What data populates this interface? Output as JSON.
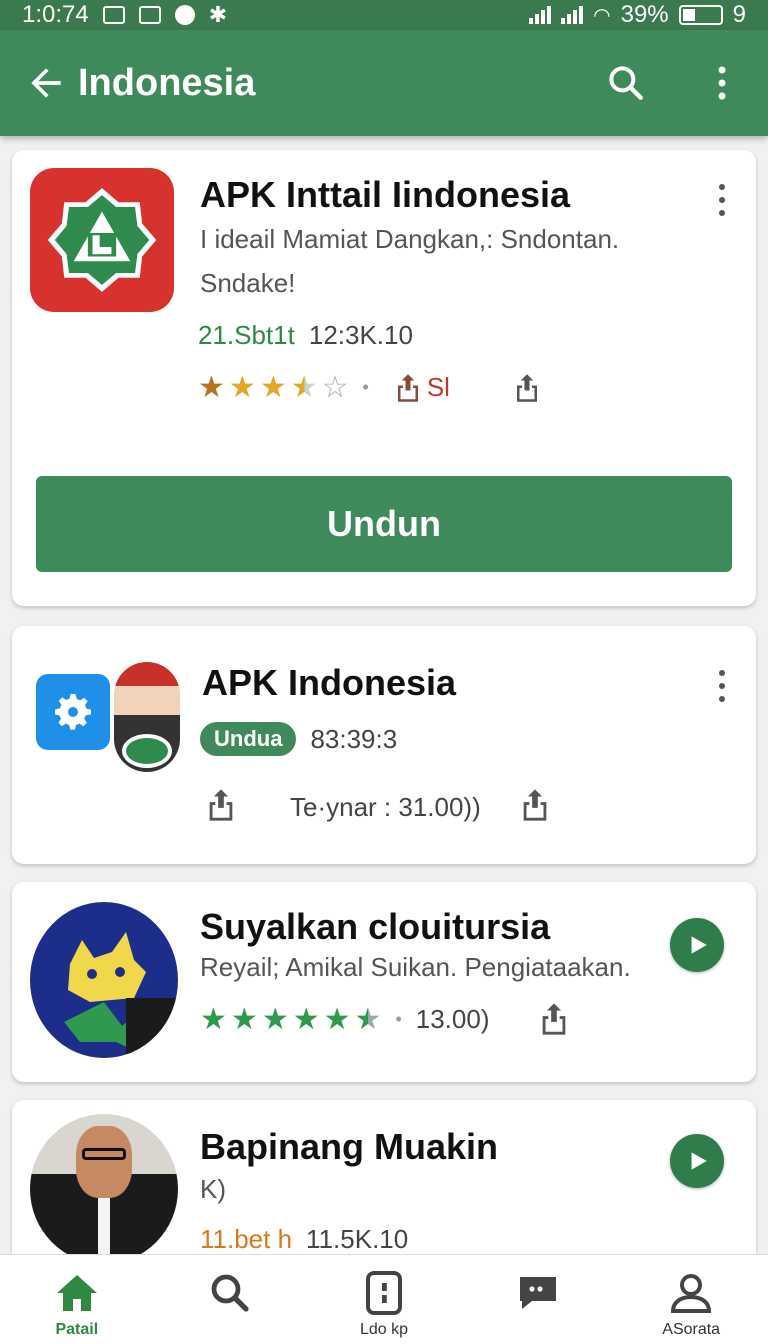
{
  "status_bar": {
    "time": "1:0:74",
    "battery": "39%",
    "extra": "9"
  },
  "app_bar": {
    "title": "Indonesia"
  },
  "cards": [
    {
      "name": "APK Inttail Iindonesia",
      "desc_line1": "I ideail Mamiat Dangkan,: Sndontan.",
      "desc_line2": "Sndake!",
      "meta_green": "21.Sbt1t",
      "meta_size": "12:3K.10",
      "rating": 3.5,
      "share_label": "Sl",
      "install_label": "Undun"
    },
    {
      "name": "APK Indonesia",
      "pill_label": "Undua",
      "meta_value": "83:39:3",
      "meta_line2": "Te·ynar : 31.00))"
    },
    {
      "name": "Suyalkan clouitursia",
      "desc": "Reyail; Amikal  Suikan. Pengiataakan.",
      "rating": 5,
      "meta_count": "13.00)"
    },
    {
      "name": "Bapinang Muakin",
      "sub": "K)",
      "meta_orange": "11.bet h",
      "meta_size": "11.5K.10"
    }
  ],
  "bottom_nav": [
    {
      "label": "Patail",
      "icon": "home-icon",
      "active": true
    },
    {
      "label": "",
      "icon": "search-icon",
      "active": false
    },
    {
      "label": "Ldo kp",
      "icon": "apps-icon",
      "active": false
    },
    {
      "label": "",
      "icon": "chat-icon",
      "active": false
    },
    {
      "label": "ASorata",
      "icon": "account-icon",
      "active": false
    }
  ],
  "colors": {
    "primary": "#3f8a5a",
    "status_bar": "#3b7a4e",
    "star": "#e2a62b",
    "green_star": "#2f9a4e"
  }
}
